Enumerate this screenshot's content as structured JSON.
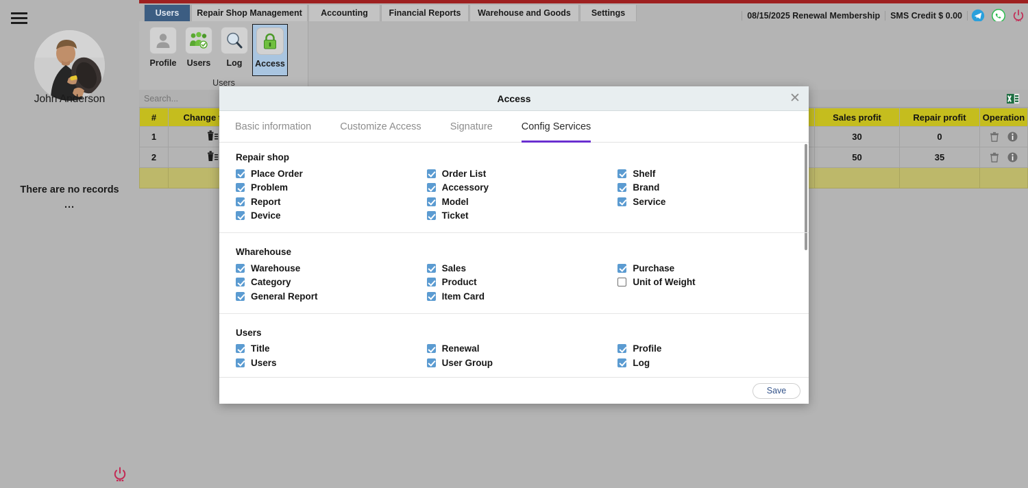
{
  "sidebar": {
    "menu_icon": "hamburger-icon",
    "user_name": "John Anderson",
    "empty_text": "There are no records",
    "empty_dots": "...",
    "power_icon": "power-icon"
  },
  "header": {
    "tabs": [
      {
        "label": "Users",
        "active": true
      },
      {
        "label": "Repair Shop Management",
        "active": false
      },
      {
        "label": "Accounting",
        "active": false
      },
      {
        "label": "Financial Reports",
        "active": false
      },
      {
        "label": "Warehouse and Goods",
        "active": false
      },
      {
        "label": "Settings",
        "active": false
      }
    ],
    "date_membership": "08/15/2025 Renewal Membership",
    "sms_credit": "SMS Credit $ 0.00",
    "telegram_icon": "telegram-icon",
    "whatsapp_icon": "whatsapp-icon",
    "power_icon": "power-icon",
    "accent_red": "#9e2020",
    "active_tab_bg": "#3c5d82"
  },
  "ribbon": {
    "group_label": "Users",
    "buttons": [
      {
        "label": "Profile",
        "icon": "person-icon",
        "selected": false
      },
      {
        "label": "Users",
        "icon": "users-group-icon",
        "selected": false
      },
      {
        "label": "Log",
        "icon": "magnifier-icon",
        "selected": false
      },
      {
        "label": "Access",
        "icon": "lock-icon",
        "selected": true
      }
    ]
  },
  "search": {
    "placeholder": "Search...",
    "value": "",
    "excel_icon": "excel-export-icon"
  },
  "table": {
    "columns": [
      "#",
      "Change token",
      "Sales profit",
      "Repair profit",
      "Operation"
    ],
    "rows": [
      {
        "num": "1",
        "change_token": "delete-token-icon",
        "sales_profit": "30",
        "repair_profit": "0",
        "operation": [
          "trash-icon",
          "info-icon"
        ]
      },
      {
        "num": "2",
        "change_token": "delete-token-icon",
        "sales_profit": "50",
        "repair_profit": "35",
        "operation": [
          "trash-icon",
          "info-icon"
        ]
      }
    ],
    "total_row": {
      "num": "",
      "change_token": "",
      "sales_profit": "",
      "repair_profit": "",
      "operation": ""
    },
    "header_bg": "#c5bd1e",
    "total_bg": "#bdb86a"
  },
  "modal": {
    "title": "Access",
    "close_icon": "close-icon",
    "accent": "#6a2fd0",
    "tabs": [
      {
        "label": "Basic information",
        "active": false
      },
      {
        "label": "Customize Access",
        "active": false
      },
      {
        "label": "Signature",
        "active": false
      },
      {
        "label": "Config Services",
        "active": true
      }
    ],
    "sections": [
      {
        "title": "Repair shop",
        "columns": [
          [
            {
              "label": "Place Order",
              "checked": true
            },
            {
              "label": "Problem",
              "checked": true
            },
            {
              "label": "Report",
              "checked": true
            },
            {
              "label": "Device",
              "checked": true
            }
          ],
          [
            {
              "label": "Order List",
              "checked": true
            },
            {
              "label": "Accessory",
              "checked": true
            },
            {
              "label": "Model",
              "checked": true
            },
            {
              "label": "Ticket",
              "checked": true
            }
          ],
          [
            {
              "label": "Shelf",
              "checked": true
            },
            {
              "label": "Brand",
              "checked": true
            },
            {
              "label": "Service",
              "checked": true
            }
          ]
        ]
      },
      {
        "title": "Wharehouse",
        "columns": [
          [
            {
              "label": "Warehouse",
              "checked": true
            },
            {
              "label": "Category",
              "checked": true
            },
            {
              "label": "General Report",
              "checked": true
            }
          ],
          [
            {
              "label": "Sales",
              "checked": true
            },
            {
              "label": "Product",
              "checked": true
            },
            {
              "label": "Item Card",
              "checked": true
            }
          ],
          [
            {
              "label": "Purchase",
              "checked": true
            },
            {
              "label": "Unit of Weight",
              "checked": false
            }
          ]
        ]
      },
      {
        "title": "Users",
        "columns": [
          [
            {
              "label": "Title",
              "checked": true
            },
            {
              "label": "Users",
              "checked": true
            }
          ],
          [
            {
              "label": "Renewal",
              "checked": true
            },
            {
              "label": "User Group",
              "checked": true
            }
          ],
          [
            {
              "label": "Profile",
              "checked": true
            },
            {
              "label": "Log",
              "checked": true
            }
          ]
        ]
      }
    ],
    "save_label": "Save"
  }
}
